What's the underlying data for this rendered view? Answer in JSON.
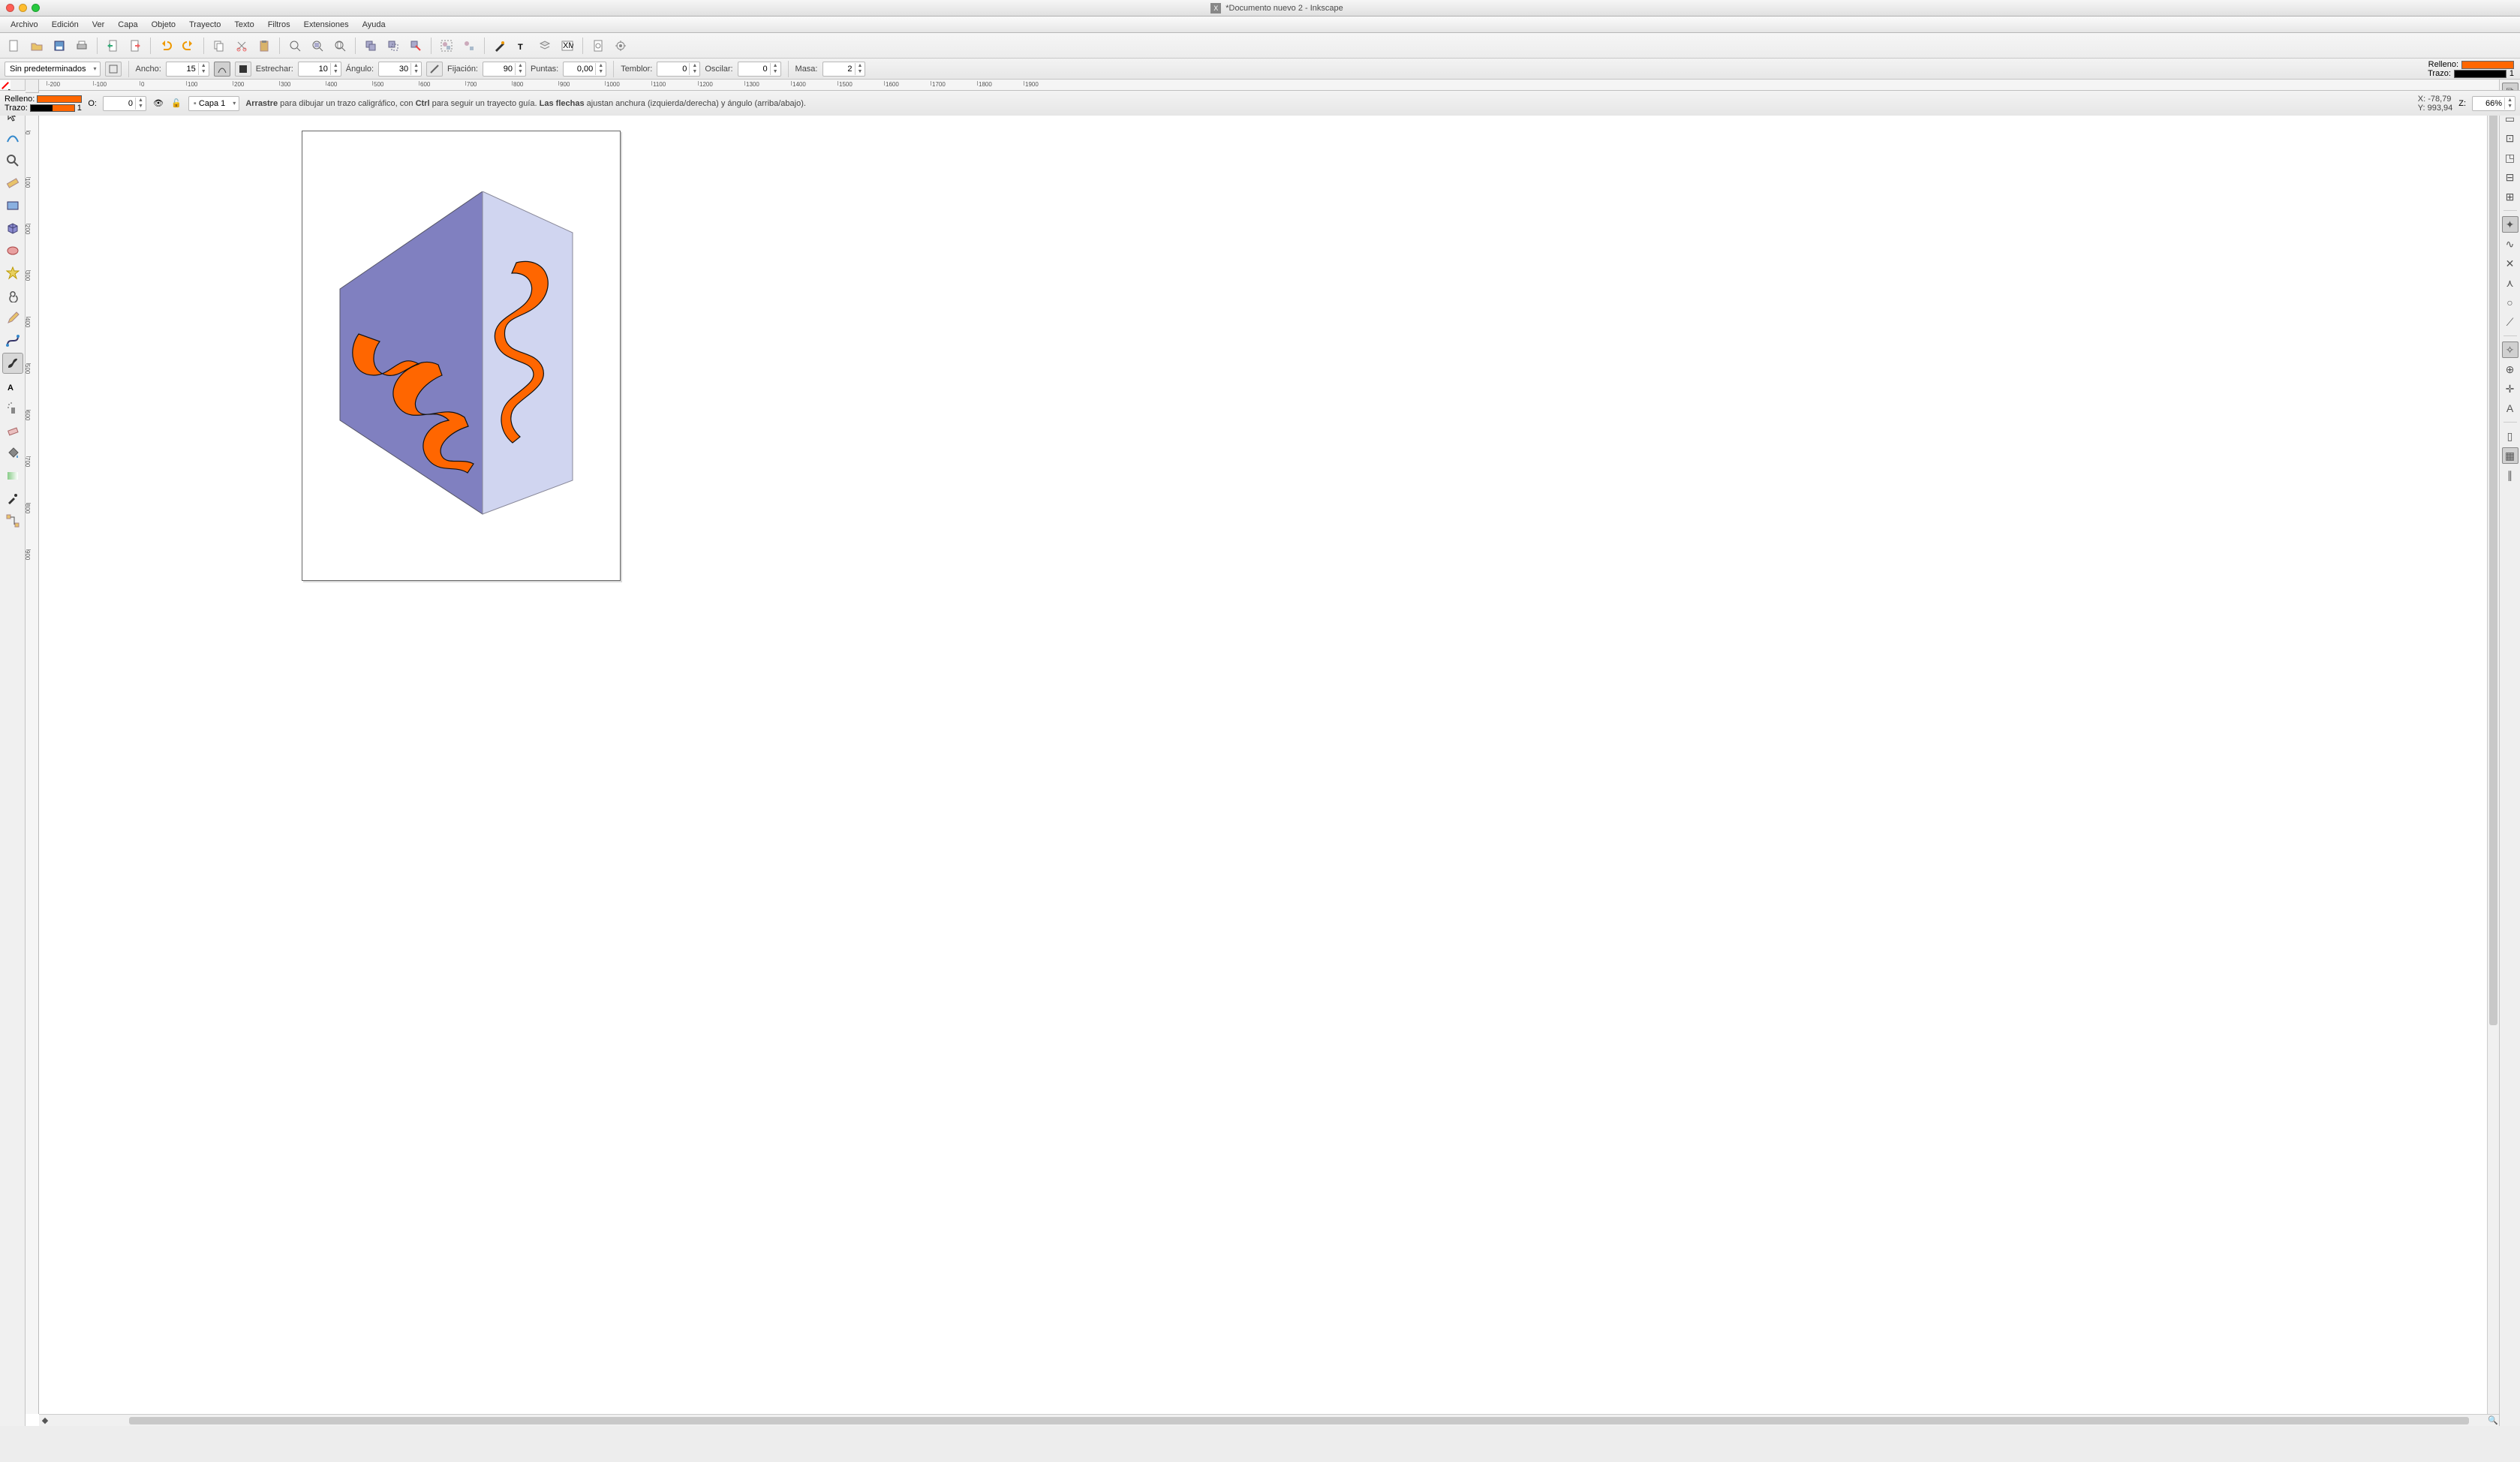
{
  "window": {
    "title": "*Documento nuevo 2 - Inkscape"
  },
  "menubar": [
    "Archivo",
    "Edición",
    "Ver",
    "Capa",
    "Objeto",
    "Trayecto",
    "Texto",
    "Filtros",
    "Extensiones",
    "Ayuda"
  ],
  "optbar": {
    "preset_label": "Sin predeterminados",
    "width_label": "Ancho:",
    "width_value": "15",
    "thin_label": "Estrechar:",
    "thin_value": "10",
    "angle_label": "Ángulo:",
    "angle_value": "30",
    "fix_label": "Fijación:",
    "fix_value": "90",
    "caps_label": "Puntas:",
    "caps_value": "0,00",
    "tremor_label": "Temblor:",
    "tremor_value": "0",
    "wiggle_label": "Oscilar:",
    "wiggle_value": "0",
    "mass_label": "Masa:",
    "mass_value": "2"
  },
  "fill_label": "Relleno:",
  "stroke_label": "Trazo:",
  "fill_color": "#ff6600",
  "stroke_color": "#000000",
  "stroke_alpha": "1",
  "status": {
    "relleno": "Relleno:",
    "trazo": "Trazo:",
    "opacity_label": "O:",
    "opacity_value": "0",
    "layer_label": "Capa 1",
    "hint_a": "Arrastre",
    "hint_b": " para dibujar un trazo caligráfico, con ",
    "hint_c": "Ctrl",
    "hint_d": " para seguir un trayecto guía. ",
    "hint_e": "Las flechas",
    "hint_f": " ajustan anchura (izquierda/derecha) y ángulo (arriba/abajo).",
    "x_label": "X:",
    "x_val": "-78,79",
    "y_label": "Y:",
    "y_val": "993,94",
    "z_label": "Z:",
    "zoom": "66%"
  },
  "ruler_ticks": [
    "-200",
    "-100",
    "0",
    "100",
    "200",
    "300",
    "400",
    "500",
    "600",
    "700",
    "800",
    "900",
    "1000",
    "1100",
    "1200",
    "1300",
    "1400",
    "1500",
    "1600",
    "1700",
    "1800",
    "1900"
  ],
  "vruler_ticks": [
    "0",
    "100",
    "200",
    "300",
    "400",
    "500",
    "600",
    "700",
    "800",
    "900"
  ],
  "palette_colors": [
    "#000",
    "#1a1a1a",
    "#333",
    "#4d4d4d",
    "#666",
    "#808080",
    "#999",
    "#b3b3b3",
    "#ccc",
    "#e6e6e6",
    "#fff",
    "#f00",
    "#ff6600",
    "#ff0",
    "#8f0",
    "#0f0",
    "#0f8",
    "#0ff",
    "#08f",
    "#00f",
    "#80f",
    "#f0f",
    "#f08",
    "#800",
    "#830",
    "#880",
    "#480",
    "#080",
    "#084",
    "#088",
    "#048",
    "#008",
    "#408",
    "#808",
    "#804",
    "#400",
    "#420",
    "#440",
    "#240",
    "#040",
    "#042",
    "#044",
    "#024",
    "#004",
    "#204",
    "#404",
    "#402",
    "#fcc",
    "#fec",
    "#ffc",
    "#cfc",
    "#cff",
    "#ccf",
    "#fcf",
    "#f99",
    "#fc9",
    "#ff9",
    "#9f9",
    "#9ff",
    "#99f",
    "#f9f",
    "#c66",
    "#c96",
    "#cc6",
    "#6c6",
    "#6cc",
    "#66c",
    "#c6c",
    "#933",
    "#963",
    "#993",
    "#393",
    "#399",
    "#339",
    "#939",
    "#a52",
    "#a82",
    "#aa2",
    "#5a2",
    "#2a5",
    "#2aa",
    "#25a",
    "#52a",
    "#a25",
    "#c80",
    "#cc0",
    "#8c0",
    "#0c8",
    "#08c",
    "#80c",
    "#c08",
    "#fa0",
    "#af0",
    "#0fa",
    "#0af",
    "#a0f",
    "#f0a"
  ]
}
